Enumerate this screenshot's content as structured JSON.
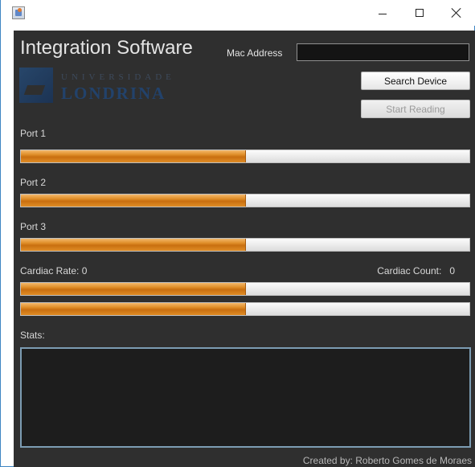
{
  "window": {
    "minimize_icon": "minimize-icon",
    "maximize_icon": "maximize-icon",
    "close_icon": "close-icon"
  },
  "header": {
    "title": "Integration Software",
    "mac_label": "Mac Address",
    "mac_value": ""
  },
  "logo": {
    "line1": "UNIVERSIDADE",
    "line2": "LONDRINA"
  },
  "buttons": {
    "search": "Search Device",
    "start": "Start Reading"
  },
  "ports": [
    {
      "label": "Port 1",
      "progress": 0.5
    },
    {
      "label": "Port 2",
      "progress": 0.5
    },
    {
      "label": "Port 3",
      "progress": 0.5
    }
  ],
  "cardiac": {
    "rate_label": "Cardiac Rate:",
    "rate_value": "0",
    "count_label": "Cardiac Count:",
    "count_value": "0",
    "bars": [
      0.5,
      0.5
    ]
  },
  "stats": {
    "label": "Stats:",
    "text": ""
  },
  "footer": {
    "credit": "Created by: Roberto Gomes de Moraes"
  },
  "colors": {
    "background": "#2f2f2f",
    "accent": "#e08f2a",
    "border": "#3f86c3"
  }
}
